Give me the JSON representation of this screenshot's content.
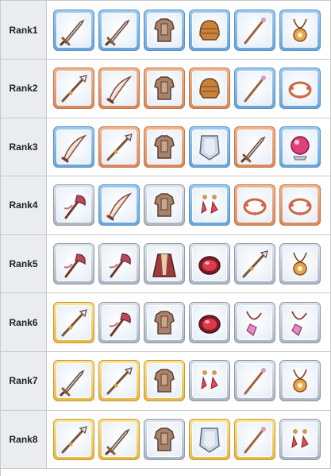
{
  "colors": {
    "header_bg": "#eaecf0",
    "border": "#c9c9c9",
    "frame_blue": "#6aa6dc",
    "frame_copper": "#d88a5f",
    "frame_silver": "#aeb6c4",
    "frame_gold": "#e6b94c",
    "frame_purple": "#a98ad3"
  },
  "ranks": [
    {
      "label": "Rank1",
      "items": [
        {
          "icon": "sword-icon",
          "frame": "blue"
        },
        {
          "icon": "sword-icon",
          "frame": "blue"
        },
        {
          "icon": "armor-icon",
          "frame": "blue"
        },
        {
          "icon": "helmet-icon",
          "frame": "blue"
        },
        {
          "icon": "staff-icon",
          "frame": "blue"
        },
        {
          "icon": "amulet-icon",
          "frame": "blue"
        }
      ]
    },
    {
      "label": "Rank2",
      "items": [
        {
          "icon": "spear-icon",
          "frame": "copper"
        },
        {
          "icon": "scimitar-icon",
          "frame": "copper"
        },
        {
          "icon": "armor-icon",
          "frame": "copper"
        },
        {
          "icon": "helmet-icon",
          "frame": "copper"
        },
        {
          "icon": "staff-icon",
          "frame": "blue"
        },
        {
          "icon": "bracelet-icon",
          "frame": "blue"
        }
      ]
    },
    {
      "label": "Rank3",
      "items": [
        {
          "icon": "scimitar-icon",
          "frame": "blue"
        },
        {
          "icon": "spear-icon",
          "frame": "copper"
        },
        {
          "icon": "armor-icon",
          "frame": "copper"
        },
        {
          "icon": "shield-icon",
          "frame": "blue"
        },
        {
          "icon": "sword-icon",
          "frame": "copper"
        },
        {
          "icon": "orb-icon",
          "frame": "blue"
        }
      ]
    },
    {
      "label": "Rank4",
      "items": [
        {
          "icon": "axe-icon",
          "frame": "silver"
        },
        {
          "icon": "scimitar-icon",
          "frame": "blue"
        },
        {
          "icon": "armor-icon",
          "frame": "silver"
        },
        {
          "icon": "earrings-icon",
          "frame": "blue"
        },
        {
          "icon": "bracelet-icon",
          "frame": "copper"
        },
        {
          "icon": "bracelet-icon",
          "frame": "copper"
        }
      ]
    },
    {
      "label": "Rank5",
      "items": [
        {
          "icon": "axe-icon",
          "frame": "silver"
        },
        {
          "icon": "axe-icon",
          "frame": "silver"
        },
        {
          "icon": "robe-icon",
          "frame": "silver"
        },
        {
          "icon": "gem-icon",
          "frame": "silver"
        },
        {
          "icon": "spear-icon",
          "frame": "silver"
        },
        {
          "icon": "amulet-icon",
          "frame": "silver"
        }
      ]
    },
    {
      "label": "Rank6",
      "items": [
        {
          "icon": "spear-icon",
          "frame": "gold"
        },
        {
          "icon": "axe-icon",
          "frame": "silver"
        },
        {
          "icon": "armor-icon",
          "frame": "silver"
        },
        {
          "icon": "gem-icon",
          "frame": "silver"
        },
        {
          "icon": "pendant-icon",
          "frame": "silver"
        },
        {
          "icon": "pendant-icon",
          "frame": "silver"
        }
      ]
    },
    {
      "label": "Rank7",
      "items": [
        {
          "icon": "sword-icon",
          "frame": "gold"
        },
        {
          "icon": "spear-icon",
          "frame": "gold"
        },
        {
          "icon": "armor-icon",
          "frame": "gold"
        },
        {
          "icon": "earrings-icon",
          "frame": "silver"
        },
        {
          "icon": "staff-icon",
          "frame": "silver"
        },
        {
          "icon": "amulet-icon",
          "frame": "silver"
        }
      ]
    },
    {
      "label": "Rank8",
      "items": [
        {
          "icon": "spear-icon",
          "frame": "gold"
        },
        {
          "icon": "sword-icon",
          "frame": "gold"
        },
        {
          "icon": "armor-icon",
          "frame": "silver"
        },
        {
          "icon": "shield-icon",
          "frame": "gold"
        },
        {
          "icon": "staff-icon",
          "frame": "gold"
        },
        {
          "icon": "earrings-icon",
          "frame": "silver"
        }
      ]
    }
  ]
}
